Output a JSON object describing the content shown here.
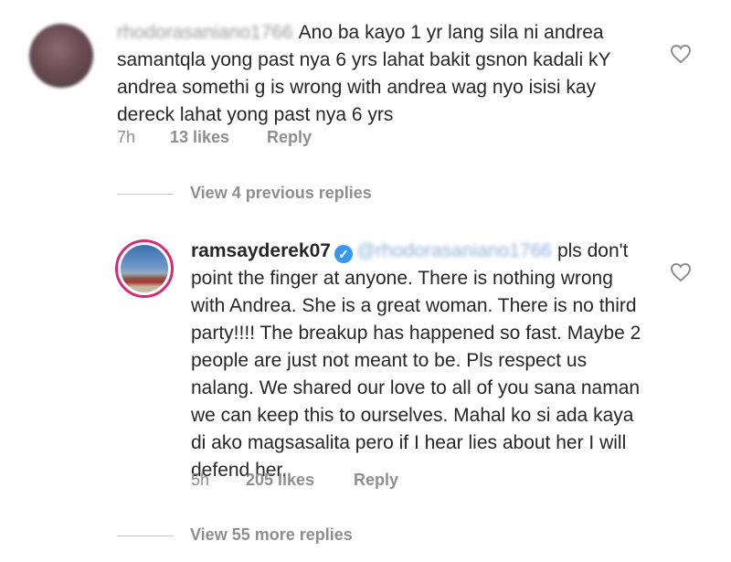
{
  "comment1": {
    "username": "rhodorasaniano1766",
    "text": "Ano ba kayo 1 yr lang sila ni andrea samantqla yong past nya 6 yrs lahat bakit gsnon kadali kY andrea somethi g is wrong with andrea wag nyo isisi kay dereck lahat yong past nya 6 yrs",
    "time": "7h",
    "likes": "13 likes",
    "reply": "Reply"
  },
  "view_previous": "View 4 previous replies",
  "comment2": {
    "username": "ramsayderek07",
    "mention": "@rhodorasaniano1766",
    "text": "pls don't point the finger at anyone. There is nothing wrong with Andrea. She is a great woman. There is no third party!!!! The breakup has happened so fast. Maybe 2 people are just not meant to be. Pls respect us nalang. We shared our love to  all of you sana naman we can keep this to ourselves. Mahal ko si ada kaya di ako magsasalita pero if I hear lies about her I will defend her.",
    "time": "5h",
    "likes": "205 likes",
    "reply": "Reply"
  },
  "view_more": "View 55 more replies",
  "icons": {
    "heart": "heart-outline-icon",
    "verified": "verified-badge-icon"
  },
  "colors": {
    "verified_blue": "#3897f0",
    "meta_gray": "#8e8e8e",
    "story_ring": "#d22d7a"
  }
}
